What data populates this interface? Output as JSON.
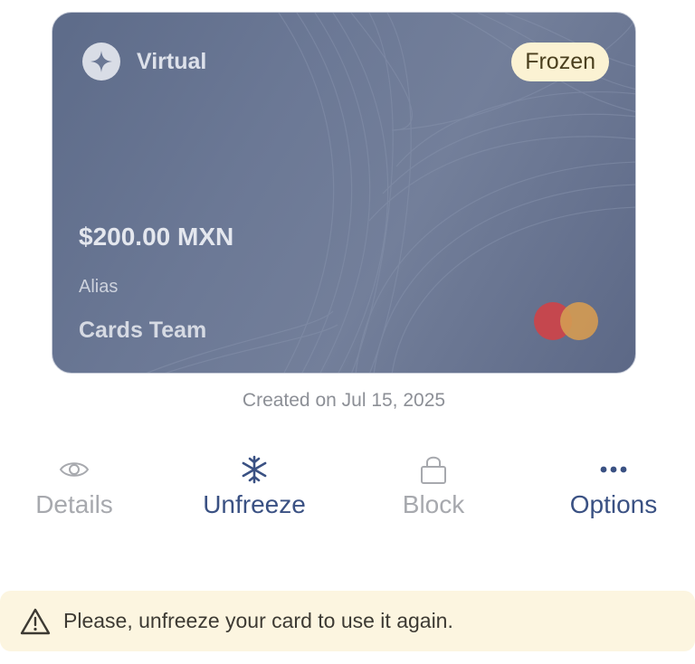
{
  "card": {
    "type_label": "Virtual",
    "status": "Frozen",
    "balance": "$200.00 MXN",
    "alias_label": "Alias",
    "alias": "Cards Team",
    "brand_icon": "mastercard-logo-icon",
    "colors": {
      "background": "#6b7895",
      "status_badge": "#fbf2d3"
    }
  },
  "created": "Created on Jul 15, 2025",
  "actions": [
    {
      "label": "Details",
      "icon": "eye-icon",
      "enabled": false
    },
    {
      "label": "Unfreeze",
      "icon": "snowflake-icon",
      "enabled": true
    },
    {
      "label": "Block",
      "icon": "lock-icon",
      "enabled": false
    },
    {
      "label": "Options",
      "icon": "more-dots-icon",
      "enabled": true
    }
  ],
  "notice": {
    "icon": "warning-icon",
    "text": "Please, unfreeze your card to use it again.",
    "background": "#fcf5e0"
  },
  "colors": {
    "accent": "#3a5183",
    "disabled": "#a7a9ae"
  }
}
